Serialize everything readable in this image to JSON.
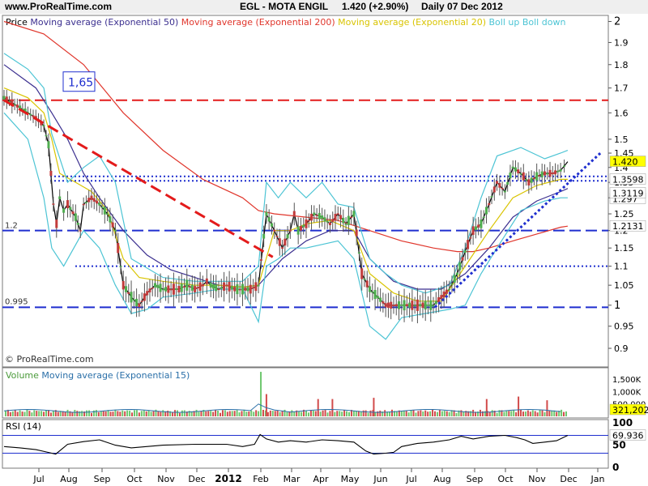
{
  "header": {
    "site": "www.ProRealTime.com",
    "instrument": "EGL - MOTA ENGIL",
    "quote": "1.420 (+2.90%)",
    "period": "Daily  07 Dec 2012",
    "watermark": "© ProRealTime.com"
  },
  "colors": {
    "price": "#000000",
    "ema50": "#3b2f8f",
    "ema200": "#e0362c",
    "ema20": "#d9c400",
    "boll": "#4cc4d4",
    "levels": "#1f2fcf",
    "resistance": "#e31b1b",
    "volume_up": "#6ec76e",
    "volume_down": "#d24b4b",
    "rsi": "#000000"
  },
  "chart_data": [
    {
      "type": "line",
      "panel": "price",
      "legend": [
        {
          "name": "Price",
          "color": "#000000"
        },
        {
          "name": "Moving average (Exponential 50)",
          "color": "#3b2f8f"
        },
        {
          "name": "Moving average (Exponential 200)",
          "color": "#e0362c"
        },
        {
          "name": "Moving average (Exponential 20)",
          "color": "#d9c400"
        },
        {
          "name": "Boll up Boll down",
          "color": "#4cc4d4"
        }
      ],
      "x_ticks": [
        "Jul",
        "Aug",
        "Sep",
        "Oct",
        "Nov",
        "Dec",
        "2012",
        "Feb",
        "Mar",
        "Apr",
        "May",
        "Jun",
        "Jul",
        "Aug",
        "Sep",
        "Oct",
        "Nov",
        "Dec",
        "Jan"
      ],
      "y_ticks": [
        "2",
        "1.9",
        "1.8",
        "1.7",
        "1.6",
        "1.5",
        "1.45",
        "1.4",
        "1.35",
        "1.3",
        "1.25",
        "1.2",
        "1.15",
        "1.1",
        "1.05",
        "1",
        "0.95",
        "0.9"
      ],
      "ylim": [
        0.86,
        2.03
      ],
      "series": [
        {
          "name": "Price",
          "x": [
            0,
            10,
            20,
            30,
            40,
            50,
            56,
            62,
            66,
            70,
            75,
            80,
            90,
            96,
            100,
            110,
            120,
            130,
            140,
            150,
            160,
            170,
            180,
            190,
            200,
            210,
            220,
            230,
            240,
            250,
            255,
            260,
            270,
            280,
            290,
            300,
            310,
            320,
            330,
            340,
            350,
            360,
            365,
            370,
            380,
            390,
            400,
            410,
            420,
            430,
            440,
            450,
            460,
            470,
            480,
            490,
            500,
            510,
            520,
            530,
            540,
            550,
            560,
            570,
            580,
            590,
            600,
            610,
            620,
            630,
            640,
            650,
            660,
            670,
            680,
            690,
            700,
            709
          ],
          "values": [
            1.66,
            1.64,
            1.62,
            1.6,
            1.58,
            1.55,
            1.48,
            1.28,
            1.22,
            1.3,
            1.26,
            1.28,
            1.24,
            1.2,
            1.28,
            1.3,
            1.28,
            1.25,
            1.2,
            1.05,
            1.02,
            1.0,
            1.03,
            1.05,
            1.04,
            1.04,
            1.04,
            1.05,
            1.04,
            1.05,
            1.06,
            1.05,
            1.04,
            1.05,
            1.04,
            1.04,
            1.04,
            1.05,
            1.25,
            1.2,
            1.15,
            1.2,
            1.25,
            1.2,
            1.22,
            1.25,
            1.24,
            1.22,
            1.25,
            1.22,
            1.25,
            1.08,
            1.04,
            1.02,
            1.0,
            1.0,
            1.0,
            1.0,
            1.0,
            1.0,
            1.0,
            1.02,
            1.04,
            1.08,
            1.14,
            1.2,
            1.22,
            1.28,
            1.35,
            1.32,
            1.4,
            1.38,
            1.35,
            1.37,
            1.38,
            1.38,
            1.39,
            1.42
          ]
        },
        {
          "name": "Moving average (Exponential 50)",
          "x": [
            0,
            40,
            60,
            80,
            100,
            120,
            150,
            180,
            210,
            240,
            270,
            300,
            320,
            350,
            380,
            410,
            440,
            460,
            490,
            520,
            550,
            580,
            610,
            640,
            670,
            700,
            709
          ],
          "values": [
            1.8,
            1.7,
            1.6,
            1.5,
            1.38,
            1.3,
            1.2,
            1.13,
            1.09,
            1.07,
            1.05,
            1.045,
            1.05,
            1.12,
            1.17,
            1.2,
            1.2,
            1.12,
            1.06,
            1.04,
            1.04,
            1.08,
            1.15,
            1.24,
            1.29,
            1.32,
            1.33
          ]
        },
        {
          "name": "Moving average (Exponential 200)",
          "x": [
            0,
            50,
            100,
            150,
            200,
            250,
            300,
            320,
            340,
            380,
            420,
            460,
            500,
            540,
            570,
            590,
            610,
            640,
            670,
            700,
            709
          ],
          "values": [
            2.0,
            1.94,
            1.8,
            1.6,
            1.46,
            1.36,
            1.3,
            1.26,
            1.25,
            1.24,
            1.23,
            1.2,
            1.17,
            1.15,
            1.14,
            1.14,
            1.15,
            1.17,
            1.19,
            1.21,
            1.213
          ]
        },
        {
          "name": "Moving average (Exponential 20)",
          "x": [
            0,
            30,
            50,
            60,
            70,
            90,
            110,
            130,
            150,
            170,
            200,
            240,
            270,
            300,
            320,
            340,
            360,
            380,
            410,
            440,
            460,
            490,
            520,
            550,
            580,
            610,
            640,
            670,
            700,
            709
          ],
          "values": [
            1.7,
            1.66,
            1.6,
            1.5,
            1.38,
            1.35,
            1.32,
            1.26,
            1.12,
            1.07,
            1.06,
            1.05,
            1.05,
            1.045,
            1.05,
            1.2,
            1.2,
            1.22,
            1.23,
            1.2,
            1.08,
            1.03,
            1.01,
            1.01,
            1.1,
            1.2,
            1.3,
            1.34,
            1.36,
            1.36
          ]
        },
        {
          "name": "Boll up",
          "x": [
            0,
            30,
            50,
            60,
            80,
            100,
            120,
            140,
            160,
            200,
            240,
            270,
            300,
            320,
            330,
            345,
            360,
            380,
            400,
            420,
            440,
            460,
            480,
            500,
            530,
            560,
            580,
            600,
            620,
            650,
            680,
            700,
            709
          ],
          "values": [
            1.85,
            1.78,
            1.7,
            1.52,
            1.35,
            1.4,
            1.44,
            1.35,
            1.12,
            1.07,
            1.06,
            1.06,
            1.06,
            1.1,
            1.35,
            1.3,
            1.35,
            1.3,
            1.35,
            1.28,
            1.27,
            1.12,
            1.08,
            1.05,
            1.03,
            1.05,
            1.15,
            1.3,
            1.44,
            1.47,
            1.43,
            1.45,
            1.46
          ]
        },
        {
          "name": "Boll down",
          "x": [
            0,
            30,
            50,
            60,
            75,
            100,
            120,
            140,
            160,
            180,
            200,
            240,
            270,
            300,
            320,
            330,
            345,
            360,
            380,
            400,
            420,
            440,
            460,
            480,
            500,
            530,
            560,
            580,
            600,
            620,
            650,
            680,
            700,
            709
          ],
          "values": [
            1.6,
            1.5,
            1.3,
            1.15,
            1.1,
            1.2,
            1.15,
            1.05,
            0.98,
            0.99,
            1.02,
            1.03,
            1.04,
            1.04,
            0.96,
            1.1,
            1.12,
            1.15,
            1.15,
            1.16,
            1.17,
            1.12,
            0.95,
            0.92,
            0.97,
            0.98,
            0.99,
            1.0,
            1.08,
            1.15,
            1.26,
            1.29,
            1.3,
            1.3
          ]
        }
      ],
      "resistance_line_value": 1.65,
      "horizontal_levels": [
        {
          "value": 1.65,
          "style": "dashed",
          "color": "#e31b1b"
        },
        {
          "value": 1.37,
          "style": "dotted",
          "color": "#1f2fcf"
        },
        {
          "value": 1.355,
          "style": "dotted",
          "color": "#1f2fcf"
        },
        {
          "value": 1.2,
          "style": "dashed",
          "color": "#1f2fcf"
        },
        {
          "value": 1.1,
          "style": "dotted",
          "color": "#1f2fcf"
        },
        {
          "value": 0.995,
          "style": "dashed",
          "color": "#1f2fcf"
        }
      ],
      "trendlines": [
        {
          "style": "dashed",
          "color": "#e31b1b",
          "from": [
            0,
            1.65
          ],
          "to": [
            338,
            1.125
          ]
        },
        {
          "style": "dotted",
          "color": "#1f2fcf",
          "from": [
            542,
            0.995
          ],
          "to": [
            750,
            1.45
          ]
        }
      ],
      "annotations": [
        "1,65",
        "1.2",
        "0.995"
      ],
      "value_labels": [
        {
          "text": "1.420",
          "value": 1.42,
          "bg": "#ffff00"
        },
        {
          "text": "1.3598",
          "value": 1.36,
          "bg": "#ffffff"
        },
        {
          "text": "1.297",
          "value": 1.297,
          "bg": "#ffffff"
        },
        {
          "text": "1.3119",
          "value": 1.315,
          "bg": "#ffffff"
        },
        {
          "text": "1.2131",
          "value": 1.213,
          "bg": "#ffffff"
        }
      ]
    },
    {
      "type": "bar",
      "panel": "volume",
      "legend": [
        {
          "name": "Volume",
          "color": "#4a9a3a"
        },
        {
          "name": "Moving average (Exponential 15)",
          "color": "#2a6fa8"
        }
      ],
      "y_ticks": [
        "1,500K",
        "1,000K",
        "500,000"
      ],
      "ylim": [
        0,
        1900000
      ],
      "last_value_label": "321,202",
      "spikes": [
        {
          "x": 323,
          "value": 1800000
        },
        {
          "x": 330,
          "value": 900000
        },
        {
          "x": 395,
          "value": 700000
        },
        {
          "x": 413,
          "value": 700000
        },
        {
          "x": 465,
          "value": 750000
        },
        {
          "x": 607,
          "value": 700000
        },
        {
          "x": 647,
          "value": 800000
        },
        {
          "x": 683,
          "value": 650000
        }
      ]
    },
    {
      "type": "line",
      "panel": "rsi",
      "legend": [
        {
          "name": "RSI (14)",
          "color": "#000000"
        }
      ],
      "y_ticks": [
        "100",
        "50",
        "0"
      ],
      "ylim": [
        0,
        100
      ],
      "overbought": 70,
      "oversold": 30,
      "last_value_label": "69.936",
      "series": [
        {
          "name": "RSI (14)",
          "x": [
            0,
            20,
            40,
            55,
            65,
            80,
            100,
            120,
            140,
            160,
            200,
            240,
            280,
            300,
            315,
            322,
            330,
            345,
            360,
            380,
            400,
            420,
            440,
            455,
            465,
            480,
            490,
            500,
            520,
            540,
            560,
            575,
            590,
            610,
            630,
            645,
            655,
            665,
            680,
            695,
            709
          ],
          "values": [
            45,
            42,
            38,
            32,
            28,
            50,
            56,
            60,
            48,
            42,
            48,
            50,
            50,
            45,
            50,
            72,
            62,
            55,
            58,
            55,
            60,
            58,
            55,
            35,
            28,
            30,
            32,
            45,
            52,
            55,
            60,
            68,
            62,
            68,
            70,
            65,
            60,
            52,
            55,
            58,
            70
          ]
        }
      ]
    }
  ]
}
